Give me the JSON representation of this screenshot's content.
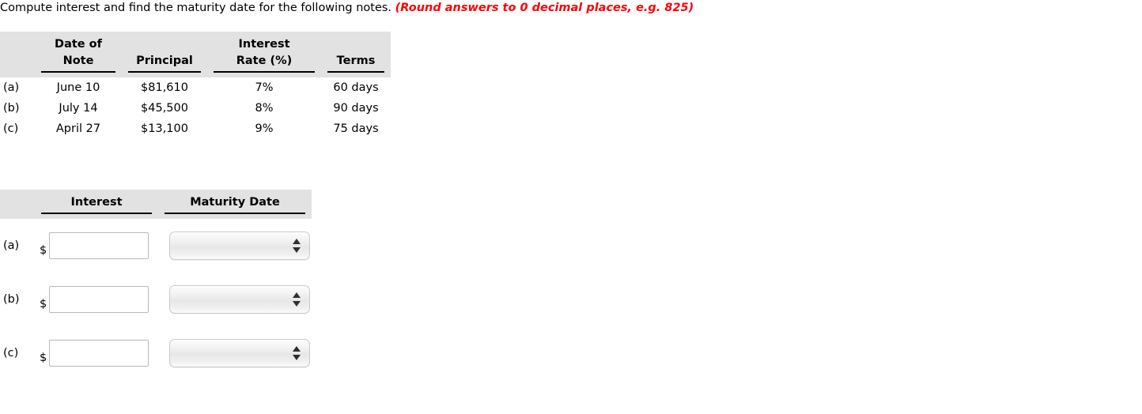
{
  "prompt": {
    "text": "Compute interest and find the maturity date for the following notes.",
    "note": "(Round answers to 0 decimal places, e.g. 825)",
    "note_color": "#fb0007"
  },
  "notes_table": {
    "headers": {
      "label": "",
      "date_of_note": "Date of\nNote",
      "principal": "Principal",
      "interest_rate": "Interest\nRate (%)",
      "terms": "Terms"
    },
    "rows": [
      {
        "label": "(a)",
        "date_of_note": "June 10",
        "principal": "$81,610",
        "interest_rate": "7%",
        "terms": "60 days"
      },
      {
        "label": "(b)",
        "date_of_note": "July 14",
        "principal": "$45,500",
        "interest_rate": "8%",
        "terms": "90 days"
      },
      {
        "label": "(c)",
        "date_of_note": "April 27",
        "principal": "$13,100",
        "interest_rate": "9%",
        "terms": "75 days"
      }
    ]
  },
  "answer_table": {
    "headers": {
      "label": "",
      "interest": "Interest",
      "maturity_date": "Maturity Date"
    },
    "rows": [
      {
        "label": "(a)",
        "currency_symbol": "$",
        "interest_value": "",
        "interest_placeholder": "",
        "maturity_date_value": "",
        "maturity_date_icon": "spinner-arrows-icon"
      },
      {
        "label": "(b)",
        "currency_symbol": "$",
        "interest_value": "",
        "interest_placeholder": "",
        "maturity_date_value": "",
        "maturity_date_icon": "spinner-arrows-icon"
      },
      {
        "label": "(c)",
        "currency_symbol": "$",
        "interest_value": "",
        "interest_placeholder": "",
        "maturity_date_value": "",
        "maturity_date_icon": "spinner-arrows-icon"
      }
    ]
  },
  "style": {
    "header_band_color": "#e2e2e2",
    "input_border_color": "#b9b9b9"
  }
}
